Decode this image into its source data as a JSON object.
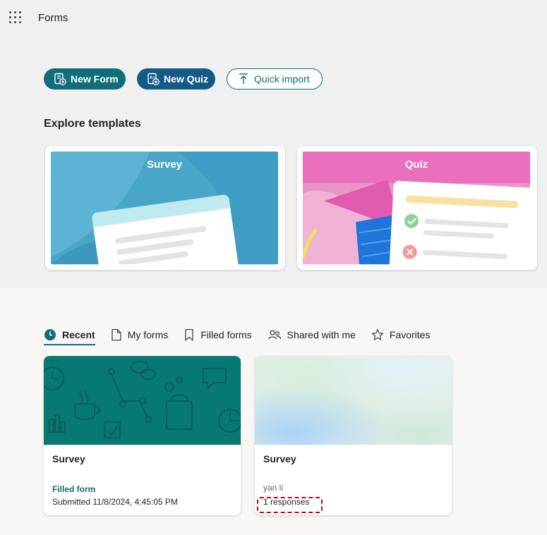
{
  "app": {
    "title": "Forms"
  },
  "actions": {
    "new_form": "New Form",
    "new_quiz": "New Quiz",
    "quick_import": "Quick import"
  },
  "templates": {
    "title": "Explore templates",
    "items": [
      {
        "label": "Survey"
      },
      {
        "label": "Quiz"
      }
    ]
  },
  "tabs": [
    {
      "label": "Recent",
      "icon": "clock-icon",
      "active": true
    },
    {
      "label": "My forms",
      "icon": "document-icon",
      "active": false
    },
    {
      "label": "Filled forms",
      "icon": "bookmark-icon",
      "active": false
    },
    {
      "label": "Shared with me",
      "icon": "people-icon",
      "active": false
    },
    {
      "label": "Favorites",
      "icon": "star-icon",
      "active": false
    }
  ],
  "recent": [
    {
      "title": "Survey",
      "status": "Filled form",
      "detail": "Submitted 11/8/2024, 4:45:05 PM"
    },
    {
      "title": "Survey",
      "owner": "yan li",
      "detail": "1 responses"
    }
  ],
  "colors": {
    "accent": "#0f6e79",
    "quiz_button": "#155a86",
    "highlight_dashed": "#d40000"
  }
}
